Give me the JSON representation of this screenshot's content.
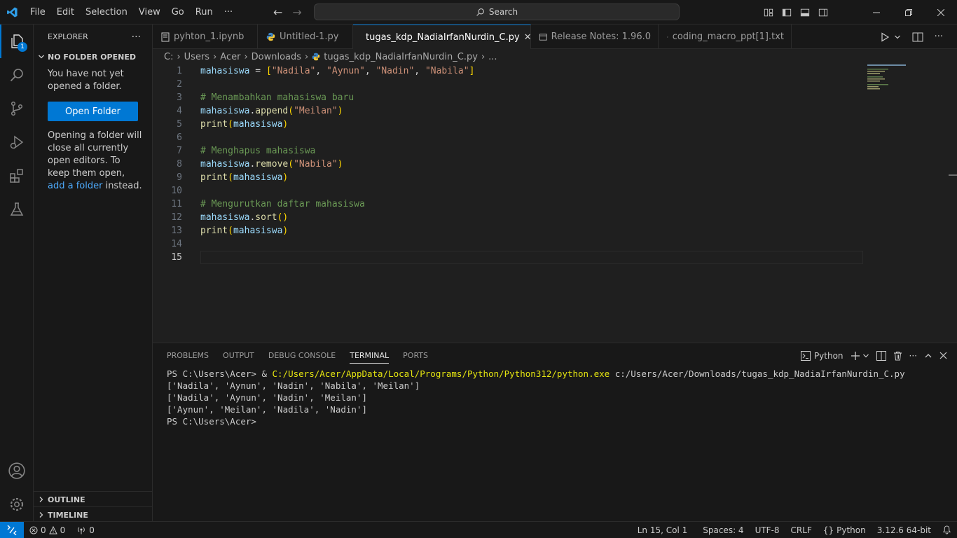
{
  "titlebar": {
    "menu": [
      "File",
      "Edit",
      "Selection",
      "View",
      "Go",
      "Run",
      "···"
    ],
    "search_label": "Search"
  },
  "activity": {
    "explorer_badge": "1"
  },
  "sidebar": {
    "title": "EXPLORER",
    "more": "···",
    "section": "NO FOLDER OPENED",
    "msg1": "You have not yet opened a folder.",
    "button": "Open Folder",
    "msg2_before": "Opening a folder will close all currently open editors. To keep them open, ",
    "msg2_link": "add a folder",
    "msg2_after": " instead.",
    "outline": "OUTLINE",
    "timeline": "TIMELINE"
  },
  "tabs": [
    {
      "label": "pyhton_1.ipynb"
    },
    {
      "label": "Untitled-1.py"
    },
    {
      "label": "tugas_kdp_NadiaIrfanNurdin_C.py"
    },
    {
      "label": "Release Notes: 1.96.0"
    },
    {
      "label": "coding_macro_ppt[1].txt"
    }
  ],
  "breadcrumb": [
    "C:",
    "Users",
    "Acer",
    "Downloads",
    "tugas_kdp_NadiaIrfanNurdin_C.py",
    "..."
  ],
  "editor": {
    "line_numbers": [
      "1",
      "2",
      "3",
      "4",
      "5",
      "6",
      "7",
      "8",
      "9",
      "10",
      "11",
      "12",
      "13",
      "14",
      "15"
    ],
    "code": {
      "l1": {
        "var": "mahasiswa",
        "op": " = ",
        "open": "[",
        "s1": "\"Nadila\"",
        "s2": "\"Aynun\"",
        "s3": "\"Nadin\"",
        "s4": "\"Nabila\"",
        "close": "]",
        "sep": ", "
      },
      "l3": "# Menambahkan mahasiswa baru",
      "l4": {
        "var": "mahasiswa",
        "fn": "append",
        "arg": "\"Meilan\""
      },
      "l5": {
        "fn": "print",
        "arg": "mahasiswa"
      },
      "l7": "# Menghapus mahasiswa",
      "l8": {
        "var": "mahasiswa",
        "fn": "remove",
        "arg": "\"Nabila\""
      },
      "l9": {
        "fn": "print",
        "arg": "mahasiswa"
      },
      "l11": "# Mengurutkan daftar mahasiswa",
      "l12": {
        "var": "mahasiswa",
        "fn": "sort"
      },
      "l13": {
        "fn": "print",
        "arg": "mahasiswa"
      }
    }
  },
  "panel": {
    "tabs": [
      "PROBLEMS",
      "OUTPUT",
      "DEBUG CONSOLE",
      "TERMINAL",
      "PORTS"
    ],
    "shell": "Python",
    "terminal": {
      "prompt": "PS C:\\Users\\Acer> ",
      "amp": "& ",
      "exe": "C:/Users/Acer/AppData/Local/Programs/Python/Python312/python.exe",
      "arg": " c:/Users/Acer/Downloads/tugas_kdp_NadiaIrfanNurdin_C.py",
      "out1": "['Nadila', 'Aynun', 'Nadin', 'Nabila', 'Meilan']",
      "out2": "['Nadila', 'Aynun', 'Nadin', 'Meilan']",
      "out3": "['Aynun', 'Meilan', 'Nadila', 'Nadin']",
      "final_prompt": "PS C:\\Users\\Acer>"
    }
  },
  "status": {
    "errors": "0",
    "warnings": "0",
    "ports": "0",
    "position": "Ln 15, Col 1",
    "spaces": "Spaces: 4",
    "encoding": "UTF-8",
    "eol": "CRLF",
    "language": "Python",
    "interpreter": "3.12.6 64-bit"
  },
  "colors": {
    "accent": "#0078d4",
    "editor_bg": "#1f1f1f",
    "chrome_bg": "#181818"
  }
}
